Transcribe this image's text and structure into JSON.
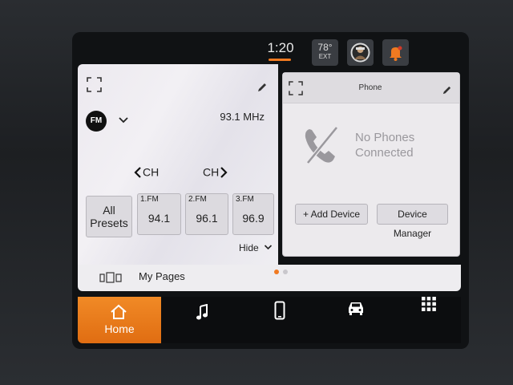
{
  "status_bar": {
    "time": "1:20",
    "temperature": "78°",
    "temperature_label": "EXT"
  },
  "radio": {
    "band": "FM",
    "frequency": "93.1 MHz",
    "ch_prev": "CH",
    "ch_next": "CH",
    "all_presets_line1": "All",
    "all_presets_line2": "Presets",
    "presets": [
      {
        "label": "1.FM",
        "freq": "94.1"
      },
      {
        "label": "2.FM",
        "freq": "96.1"
      },
      {
        "label": "3.FM",
        "freq": "96.9"
      }
    ],
    "hide_label": "Hide"
  },
  "phone": {
    "title": "Phone",
    "status_line1": "No Phones",
    "status_line2": "Connected",
    "add_device": "+ Add Device",
    "device_manager": "Device Manager"
  },
  "my_pages": {
    "label": "My Pages",
    "page_count": 2,
    "active_page": 1
  },
  "nav": {
    "home": "Home",
    "items": [
      "music-icon",
      "phone-icon",
      "vehicle-icon",
      "apps-grid-icon"
    ]
  },
  "colors": {
    "accent": "#f07a21",
    "panel": "#eceaed",
    "nav_background": "#0c0d0f"
  }
}
